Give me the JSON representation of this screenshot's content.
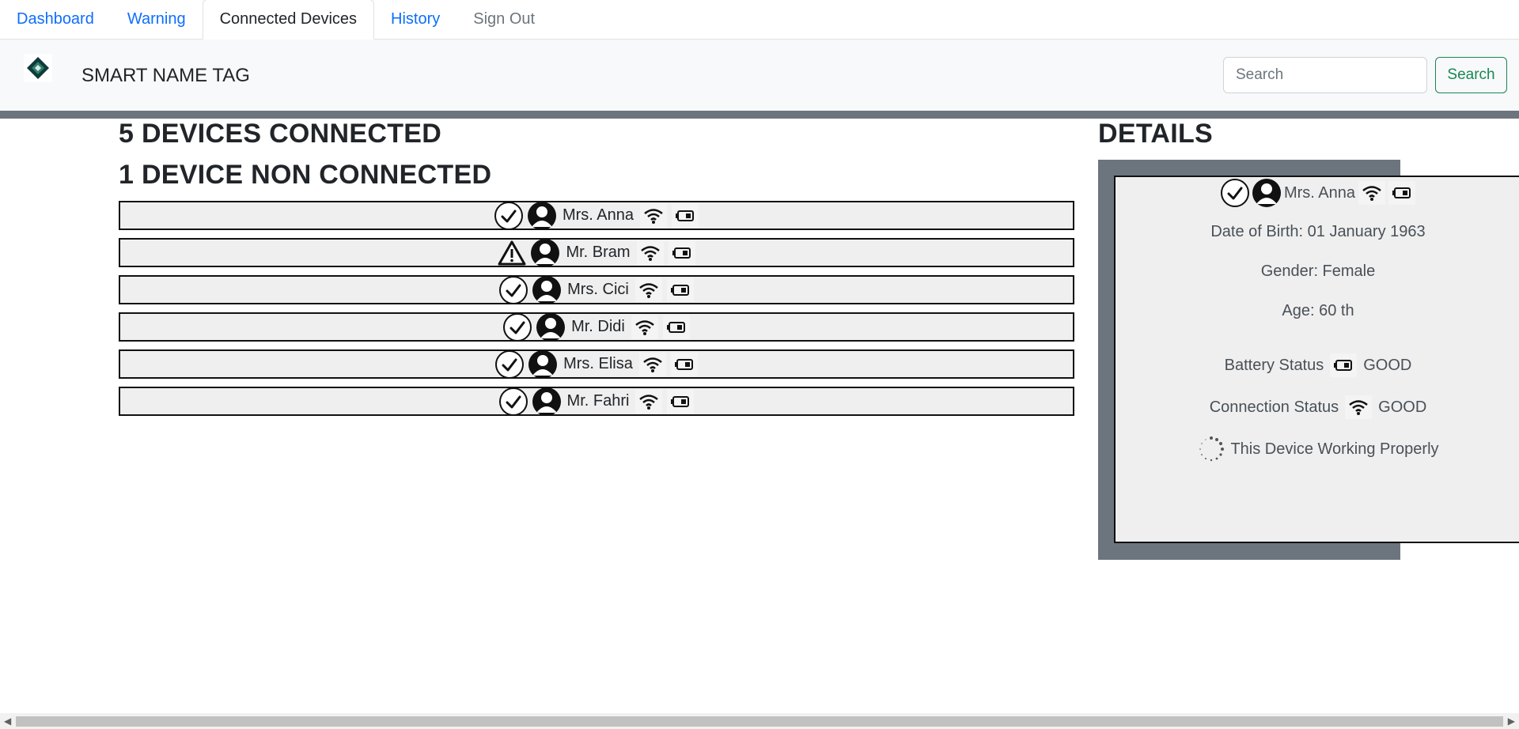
{
  "tabs": [
    {
      "label": "Dashboard"
    },
    {
      "label": "Warning"
    },
    {
      "label": "Connected Devices"
    },
    {
      "label": "History"
    },
    {
      "label": "Sign Out"
    }
  ],
  "navbar": {
    "brand": "SMART NAME TAG",
    "search_placeholder": "Search",
    "search_button": "Search"
  },
  "summary": {
    "connected": "5 DEVICES CONNECTED",
    "non_connected": "1 DEVICE NON CONNECTED"
  },
  "devices": [
    {
      "name": "Mrs. Anna",
      "status_icon": "check-icon"
    },
    {
      "name": "Mr. Bram",
      "status_icon": "warning-icon"
    },
    {
      "name": "Mrs. Cici",
      "status_icon": "check-icon"
    },
    {
      "name": "Mr. Didi",
      "status_icon": "check-icon"
    },
    {
      "name": "Mrs. Elisa",
      "status_icon": "check-icon"
    },
    {
      "name": "Mr. Fahri",
      "status_icon": "check-icon"
    }
  ],
  "details": {
    "title": "DETAILS",
    "name": "Mrs. Anna",
    "dob": "Date of Birth: 01 January 1963",
    "gender": "Gender: Female",
    "age": "Age: 60 th",
    "battery_label": "Battery Status",
    "battery_value": "GOOD",
    "connection_label": "Connection Status",
    "connection_value": "GOOD",
    "working": "This Device Working Properly"
  },
  "colors": {
    "link": "#0d6efd",
    "success": "#198754",
    "secondary": "#6c757d"
  }
}
